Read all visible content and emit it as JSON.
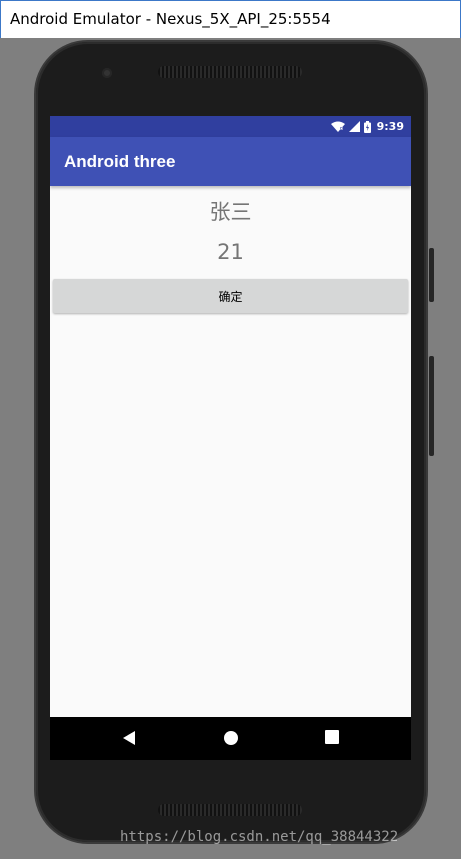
{
  "window": {
    "title": "Android Emulator - Nexus_5X_API_25:5554"
  },
  "status_bar": {
    "time": "9:39",
    "icons": [
      "wifi-icon",
      "signal-icon",
      "battery-icon"
    ],
    "background_color": "#303f9f"
  },
  "app_bar": {
    "title": "Android three",
    "background_color": "#3f51b5"
  },
  "main": {
    "name": "张三",
    "age": "21",
    "confirm_label": "确定"
  },
  "nav_bar": {
    "buttons": [
      "back-icon",
      "home-icon",
      "recents-icon"
    ]
  },
  "watermark": "https://blog.csdn.net/qq_38844322"
}
